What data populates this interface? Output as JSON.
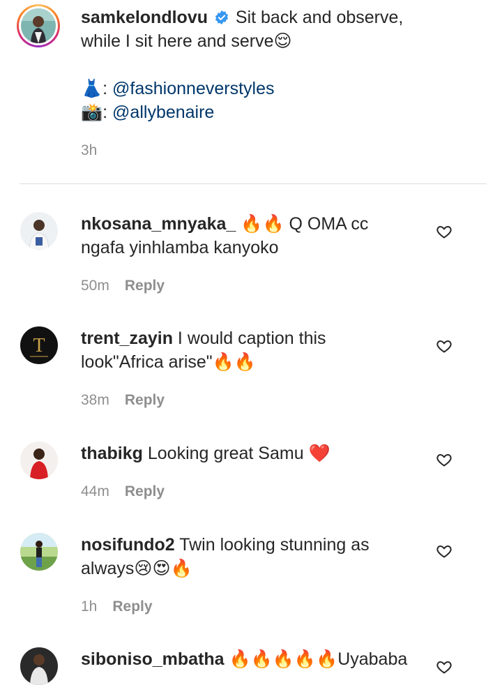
{
  "post": {
    "username": "samkelondlovu",
    "caption_line1": "Sit back and observe,",
    "caption_line2": "while I sit here and serve",
    "caption_emoji": "😌",
    "credit1_emoji": "👗",
    "credit1_handle": "@fashionneverstyles",
    "credit2_emoji": "📸",
    "credit2_handle": "@allybenaire",
    "time": "3h"
  },
  "reply_label": "Reply",
  "comments": [
    {
      "username": "nkosana_mnyaka_",
      "line1_emoji": "🔥🔥",
      "line1_text": " Q OMA cc",
      "line2": "ngafa yinhlamba kanyoko",
      "time": "50m"
    },
    {
      "username": "trent_zayin",
      "line1_text": " I would caption this",
      "line2": "look\"Africa arise\"",
      "line2_emoji": "🔥🔥",
      "time": "38m"
    },
    {
      "username": "thabikg",
      "line1_text": " Looking great Samu ",
      "line1_emoji": "❤️",
      "time": "44m"
    },
    {
      "username": "nosifundo2",
      "line1_text": " Twin looking stunning as",
      "line2": "always",
      "line2_emoji": "😢😍🔥",
      "time": "1h"
    },
    {
      "username": "siboniso_mbatha",
      "line1_emoji": "🔥🔥🔥🔥🔥",
      "line1_text": "Uyababa"
    }
  ],
  "colors": {
    "verified": "#3897f0",
    "link": "#00376b",
    "meta": "#8e8e8e",
    "divider": "#dbdbdb"
  }
}
